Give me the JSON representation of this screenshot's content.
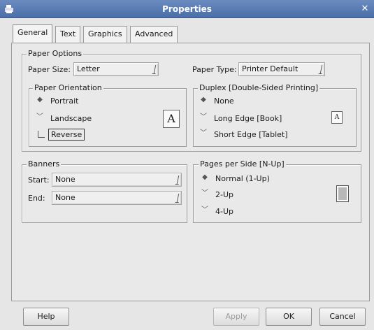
{
  "window": {
    "title": "Properties"
  },
  "tabs": [
    {
      "label": "General",
      "active": true
    },
    {
      "label": "Text",
      "active": false
    },
    {
      "label": "Graphics",
      "active": false
    },
    {
      "label": "Advanced",
      "active": false
    }
  ],
  "paper_options": {
    "legend": "Paper Options",
    "paper_size_label": "Paper Size:",
    "paper_size_value": "Letter",
    "paper_type_label": "Paper Type:",
    "paper_type_value": "Printer Default",
    "orientation": {
      "legend": "Paper Orientation",
      "options": [
        {
          "label": "Portrait",
          "selected": true
        },
        {
          "label": "Landscape",
          "selected": false
        }
      ],
      "reverse_label": "Reverse",
      "preview_letter": "A"
    },
    "duplex": {
      "legend": "Duplex [Double-Sided Printing]",
      "options": [
        {
          "label": "None",
          "selected": true
        },
        {
          "label": "Long Edge [Book]",
          "selected": false
        },
        {
          "label": "Short Edge [Tablet]",
          "selected": false
        }
      ],
      "preview_letter": "A"
    }
  },
  "banners": {
    "legend": "Banners",
    "start_label": "Start:",
    "start_value": "None",
    "end_label": "End:",
    "end_value": "None"
  },
  "pages_per_side": {
    "legend": "Pages per Side [N-Up]",
    "options": [
      {
        "label": "Normal (1-Up)",
        "selected": true
      },
      {
        "label": "2-Up",
        "selected": false
      },
      {
        "label": "4-Up",
        "selected": false
      }
    ]
  },
  "buttons": {
    "help": "Help",
    "apply": "Apply",
    "ok": "OK",
    "cancel": "Cancel"
  },
  "colors": {
    "titlebar": "#5a7cb4",
    "window_bg": "#e6e6e6"
  }
}
